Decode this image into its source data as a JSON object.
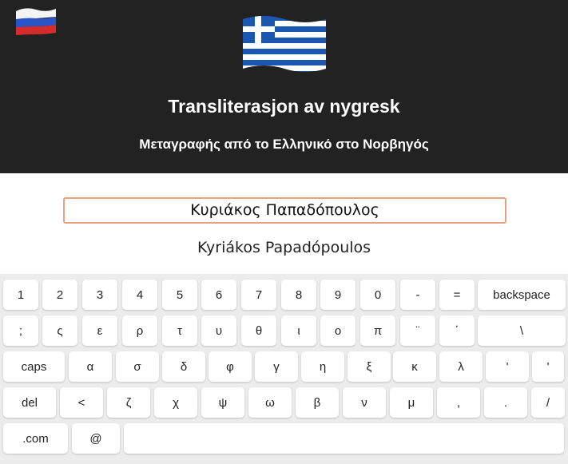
{
  "header": {
    "title": "Transliterasjon av nygresk",
    "subtitle": "Μεταγραφής από το Ελληνικό στο Νορβηγός",
    "russian_flag_icon": "russia-flag-icon",
    "greek_flag_icon": "greece-flag-icon"
  },
  "input": {
    "value": "Κυριάκος Παπαδόπουλος"
  },
  "output": {
    "text": "Kyriákos Papadópoulos"
  },
  "keyboard": {
    "row1": [
      "1",
      "2",
      "3",
      "4",
      "5",
      "6",
      "7",
      "8",
      "9",
      "0",
      "-",
      "=",
      "backspace"
    ],
    "row2": [
      ";",
      "ς",
      "ε",
      "ρ",
      "τ",
      "υ",
      "θ",
      "ι",
      "ο",
      "π",
      "¨",
      "΄",
      "\\"
    ],
    "row3": [
      "caps",
      "α",
      "σ",
      "δ",
      "φ",
      "γ",
      "η",
      "ξ",
      "κ",
      "λ",
      "'",
      "'"
    ],
    "row4": [
      "del",
      "<",
      "ζ",
      "χ",
      "ψ",
      "ω",
      "β",
      "ν",
      "μ",
      ",",
      ".",
      "/"
    ],
    "row5": [
      ".com",
      "@",
      ""
    ]
  },
  "colors": {
    "header_bg": "#222222",
    "input_border": "#e8a07e",
    "keyboard_bg": "#ececec"
  }
}
